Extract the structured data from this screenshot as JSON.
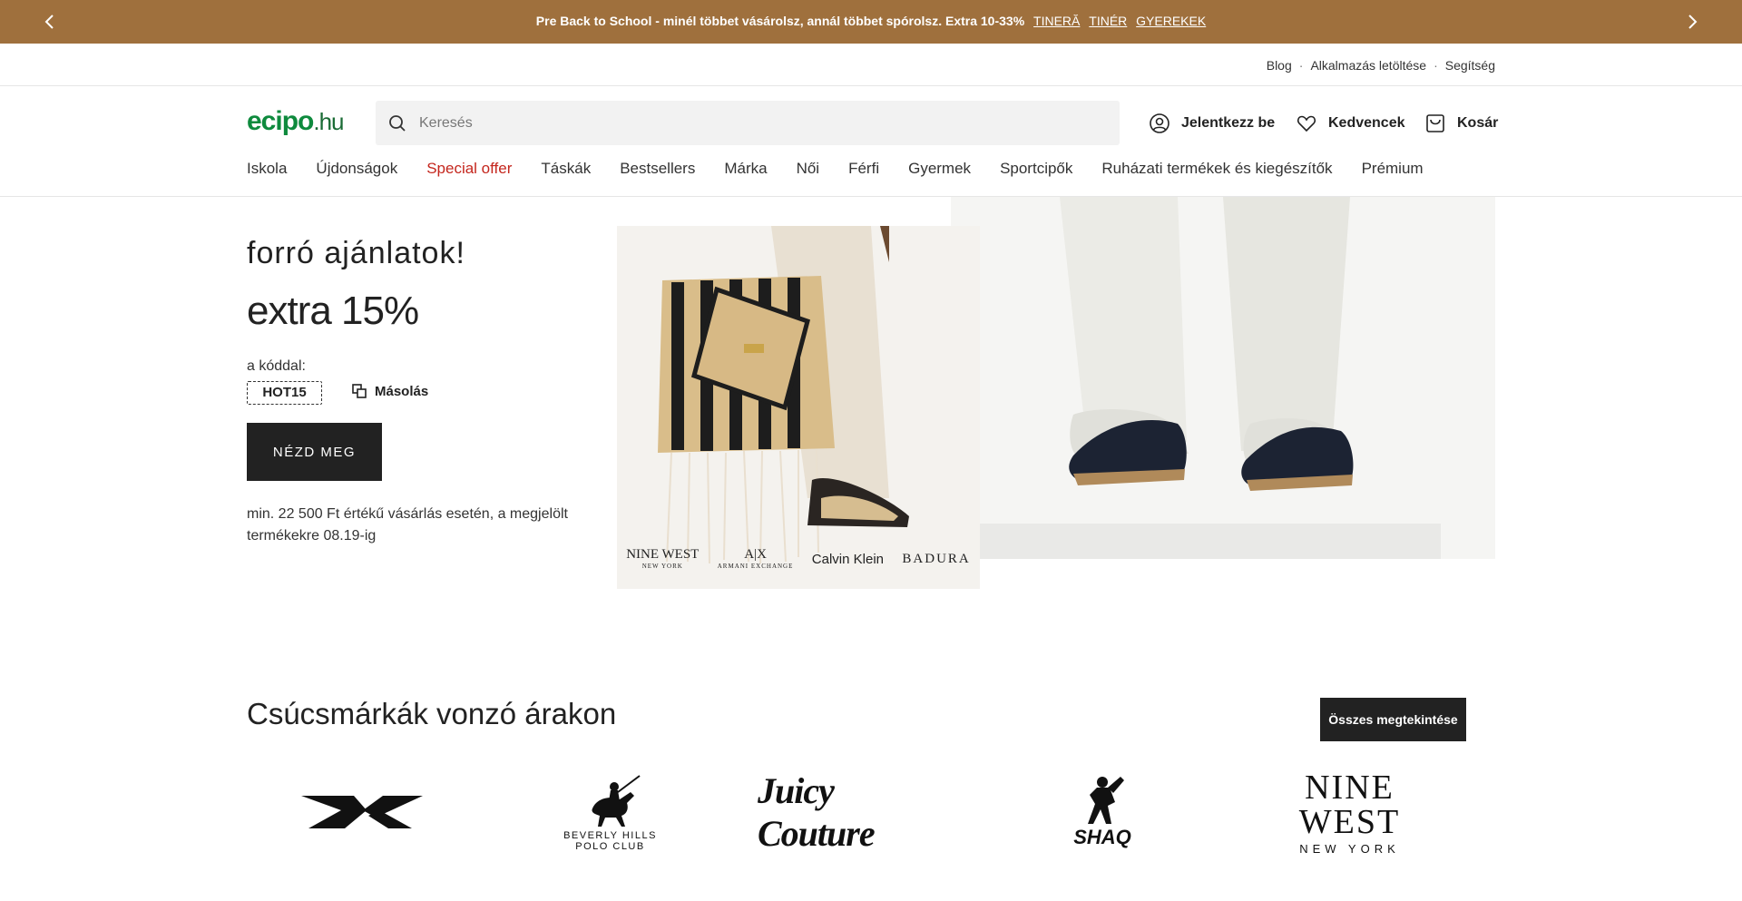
{
  "promo": {
    "text": "Pre Back to School - minél többet vásárolsz, annál többet spórolsz. Extra 10-33%",
    "links": [
      "TINERĂ",
      "TINÉR",
      "GYEREKEK"
    ]
  },
  "util_links": [
    "Blog",
    "Alkalmazás letöltése",
    "Segítség"
  ],
  "header": {
    "logo_main": "ecipo",
    "logo_tld": ".hu",
    "search_placeholder": "Keresés",
    "login": "Jelentkezz be",
    "favorites": "Kedvencek",
    "cart": "Kosár"
  },
  "nav": [
    "Iskola",
    "Újdonságok",
    "Special offer",
    "Táskák",
    "Bestsellers",
    "Márka",
    "Női",
    "Férfi",
    "Gyermek",
    "Sportcipők",
    "Ruházati termékek és kiegészítők",
    "Prémium"
  ],
  "hero": {
    "title1": "forró ajánlatok!",
    "title2": "extra 15%",
    "code_label": "a kóddal:",
    "code": "HOT15",
    "copy": "Másolás",
    "cta": "NÉZD MEG",
    "note": "min. 22 500 Ft értékű vásárlás esetén, a megjelölt termékekre 08.19-ig",
    "brands": {
      "nine_west": "NINE WEST",
      "nine_west_sub": "NEW YORK",
      "ax": "A|X",
      "ax_sub": "ARMANI EXCHANGE",
      "ck": "Calvin Klein",
      "badura": "BADURA"
    }
  },
  "brands_section": {
    "title": "Csúcsmárkák vonzó árakon",
    "all_button": "Összes megtekintése",
    "bhpc_line1": "BEVERLY HILLS",
    "bhpc_line2": "POLO CLUB",
    "juicy": "Juicy Couture",
    "shaq": "SHAQ",
    "nw_line1": "NINE WEST",
    "nw_line2": "NEW YORK"
  },
  "colors": {
    "promo_bg": "#9f703d",
    "logo_green": "#0e8a3d",
    "special_red": "#c4261d",
    "button_dark": "#222222"
  }
}
